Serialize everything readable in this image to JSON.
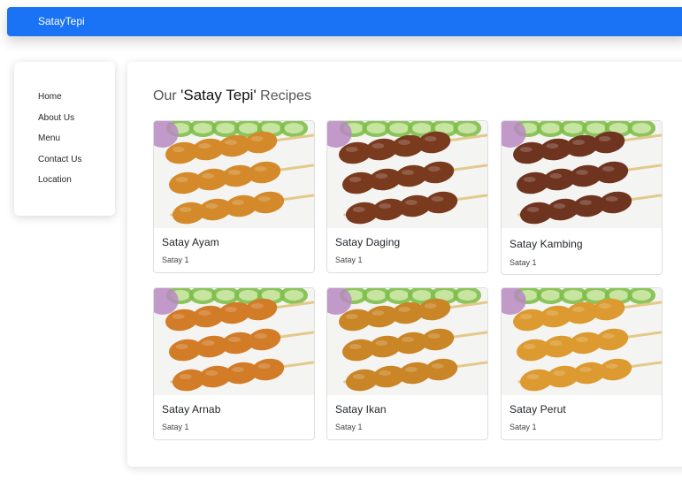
{
  "navbar": {
    "brand": "SatayTepi"
  },
  "sidebar": {
    "items": [
      {
        "label": "Home"
      },
      {
        "label": "About Us"
      },
      {
        "label": "Menu"
      },
      {
        "label": "Contact Us"
      },
      {
        "label": "Location"
      }
    ]
  },
  "main": {
    "title_prefix": "Our ",
    "title_highlight": "'Satay Tepi'",
    "title_suffix": " Recipes",
    "cards": [
      {
        "name": "Satay Ayam",
        "subtitle": "Satay 1",
        "meat_color": "#d48a2a",
        "image_icon": "chicken-satay-photo"
      },
      {
        "name": "Satay Daging",
        "subtitle": "Satay 1",
        "meat_color": "#7a3a1e",
        "image_icon": "beef-satay-photo"
      },
      {
        "name": "Satay Kambing",
        "subtitle": "Satay 1",
        "meat_color": "#6e3420",
        "image_icon": "mutton-satay-photo"
      },
      {
        "name": "Satay Arnab",
        "subtitle": "Satay 1",
        "meat_color": "#d27c28",
        "image_icon": "rabbit-satay-photo"
      },
      {
        "name": "Satay Ikan",
        "subtitle": "Satay 1",
        "meat_color": "#c98526",
        "image_icon": "fish-satay-photo"
      },
      {
        "name": "Satay Perut",
        "subtitle": "Satay 1",
        "meat_color": "#dc9a30",
        "image_icon": "tripe-satay-photo"
      }
    ]
  },
  "colors": {
    "navbar_bg": "#1a73f5",
    "cucumber": "#7fbf4a",
    "onion": "#b88ac2",
    "skewer": "#e3c98a"
  }
}
